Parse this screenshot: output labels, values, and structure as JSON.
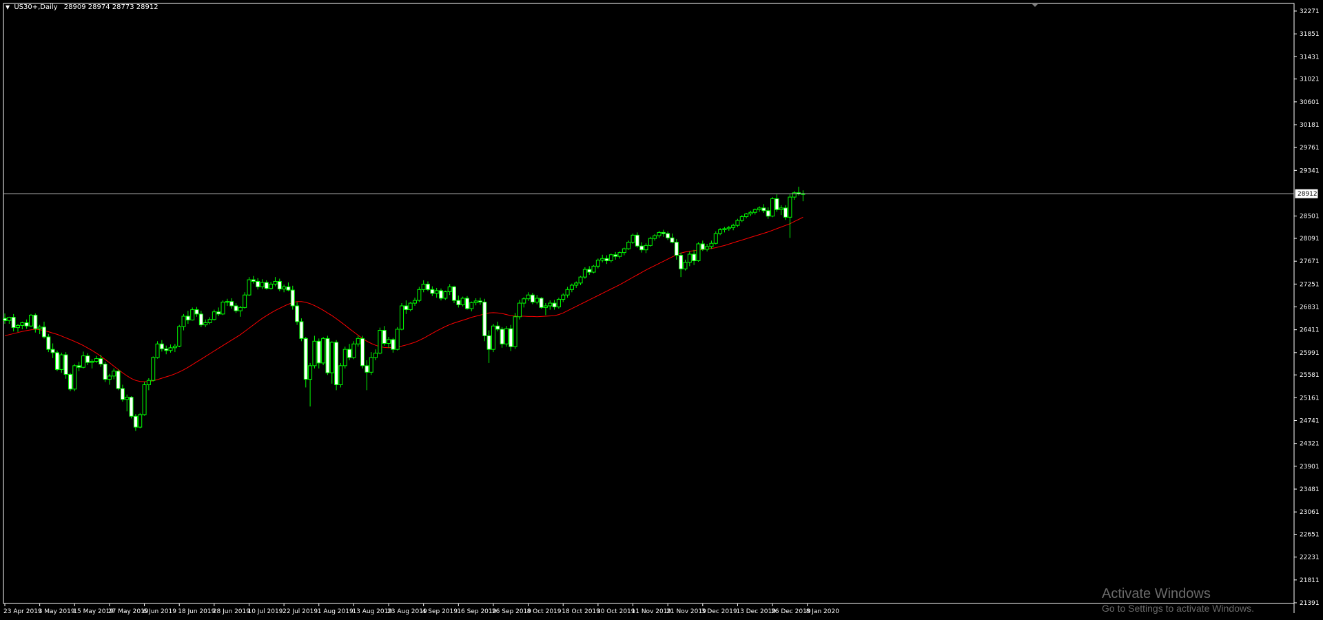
{
  "header": {
    "symbol_label": "US30+,Daily",
    "ohlc_label": "28909 28974 28773 28912"
  },
  "watermark": {
    "title": "Activate Windows",
    "subtitle": "Go to Settings to activate Windows."
  },
  "colors": {
    "background": "#000000",
    "frame": "#ffffff",
    "bull_candle": "#00ff00",
    "bull_body": "#000000",
    "bear_body": "#ffffff",
    "moving_average": "#ff0000",
    "price_line": "#c0c0c0"
  },
  "chart_data": {
    "type": "candlestick",
    "title": "",
    "symbol": "US30+",
    "timeframe": "Daily",
    "current_price": 28912,
    "current_price_label": "28912",
    "ylim": [
      21391,
      32271
    ],
    "y_ticks": [
      32271,
      31851,
      31431,
      31021,
      30601,
      30181,
      29761,
      29341,
      28501,
      28091,
      27671,
      27251,
      26831,
      26411,
      25991,
      25581,
      25161,
      24741,
      24321,
      23901,
      23481,
      23061,
      22651,
      22231,
      21811,
      21391
    ],
    "x_ticks": [
      "23 Apr 2019",
      "3 May 2019",
      "15 May 2019",
      "27 May 2019",
      "6 Jun 2019",
      "18 Jun 2019",
      "28 Jun 2019",
      "10 Jul 2019",
      "22 Jul 2019",
      "1 Aug 2019",
      "13 Aug 2019",
      "23 Aug 2019",
      "4 Sep 2019",
      "16 Sep 2019",
      "26 Sep 2019",
      "8 Oct 2019",
      "18 Oct 2019",
      "30 Oct 2019",
      "11 Nov 2019",
      "21 Nov 2019",
      "3 Dec 2019",
      "13 Dec 2019",
      "26 Dec 2019",
      "8 Jan 2020"
    ],
    "bars_per_tick": 8,
    "candles_ohlc": [
      [
        26620,
        26710,
        26520,
        26580
      ],
      [
        26580,
        26650,
        26520,
        26640
      ],
      [
        26640,
        26700,
        26380,
        26450
      ],
      [
        26450,
        26520,
        26370,
        26490
      ],
      [
        26490,
        26560,
        26420,
        26540
      ],
      [
        26540,
        26600,
        26430,
        26480
      ],
      [
        26480,
        26700,
        26460,
        26680
      ],
      [
        26680,
        26710,
        26360,
        26430
      ],
      [
        26430,
        26500,
        26330,
        26460
      ],
      [
        26460,
        26560,
        26250,
        26280
      ],
      [
        26280,
        26330,
        26000,
        26050
      ],
      [
        26050,
        26160,
        25890,
        25990
      ],
      [
        25990,
        26030,
        25650,
        25680
      ],
      [
        25680,
        25990,
        25620,
        25950
      ],
      [
        25950,
        26000,
        25510,
        25590
      ],
      [
        25590,
        25620,
        25280,
        25320
      ],
      [
        25320,
        25780,
        25280,
        25750
      ],
      [
        25750,
        25820,
        25650,
        25720
      ],
      [
        25720,
        26010,
        25700,
        25930
      ],
      [
        25930,
        25980,
        25760,
        25810
      ],
      [
        25810,
        25870,
        25700,
        25830
      ],
      [
        25830,
        25930,
        25800,
        25880
      ],
      [
        25880,
        25950,
        25730,
        25780
      ],
      [
        25780,
        25820,
        25450,
        25500
      ],
      [
        25500,
        25600,
        25400,
        25560
      ],
      [
        25560,
        25700,
        25500,
        25650
      ],
      [
        25650,
        25680,
        25300,
        25330
      ],
      [
        25330,
        25400,
        25090,
        25130
      ],
      [
        25130,
        25220,
        24910,
        25170
      ],
      [
        25170,
        25190,
        24780,
        24820
      ],
      [
        24820,
        24860,
        24550,
        24620
      ],
      [
        24620,
        24880,
        24600,
        24850
      ],
      [
        24850,
        25450,
        24830,
        25400
      ],
      [
        25400,
        25520,
        25300,
        25480
      ],
      [
        25480,
        25920,
        25460,
        25900
      ],
      [
        25900,
        26200,
        25880,
        26150
      ],
      [
        26150,
        26220,
        26010,
        26060
      ],
      [
        26060,
        26120,
        25960,
        26030
      ],
      [
        26030,
        26140,
        25990,
        26080
      ],
      [
        26080,
        26150,
        26000,
        26110
      ],
      [
        26110,
        26500,
        26090,
        26470
      ],
      [
        26470,
        26700,
        26400,
        26660
      ],
      [
        26660,
        26760,
        26520,
        26590
      ],
      [
        26590,
        26820,
        26580,
        26780
      ],
      [
        26780,
        26830,
        26650,
        26700
      ],
      [
        26700,
        26760,
        26460,
        26500
      ],
      [
        26500,
        26600,
        26460,
        26540
      ],
      [
        26540,
        26640,
        26510,
        26600
      ],
      [
        26600,
        26780,
        26580,
        26740
      ],
      [
        26740,
        26820,
        26660,
        26700
      ],
      [
        26700,
        26950,
        26680,
        26920
      ],
      [
        26920,
        26980,
        26850,
        26930
      ],
      [
        26930,
        26990,
        26800,
        26850
      ],
      [
        26850,
        26900,
        26720,
        26760
      ],
      [
        26760,
        26850,
        26650,
        26820
      ],
      [
        26820,
        27100,
        26800,
        27050
      ],
      [
        27050,
        27380,
        27030,
        27330
      ],
      [
        27330,
        27400,
        27260,
        27300
      ],
      [
        27300,
        27360,
        27150,
        27200
      ],
      [
        27200,
        27340,
        27160,
        27280
      ],
      [
        27280,
        27320,
        27150,
        27170
      ],
      [
        27170,
        27290,
        27150,
        27250
      ],
      [
        27250,
        27380,
        27210,
        27300
      ],
      [
        27300,
        27350,
        27120,
        27160
      ],
      [
        27160,
        27240,
        27100,
        27200
      ],
      [
        27200,
        27280,
        27120,
        27140
      ],
      [
        27140,
        27220,
        26780,
        26850
      ],
      [
        26850,
        26920,
        26500,
        26560
      ],
      [
        26560,
        26620,
        26200,
        26250
      ],
      [
        26250,
        26280,
        25350,
        25500
      ],
      [
        25500,
        25800,
        25000,
        25750
      ],
      [
        25750,
        26300,
        25700,
        26200
      ],
      [
        26200,
        26250,
        25700,
        25800
      ],
      [
        25800,
        26280,
        25760,
        26250
      ],
      [
        26250,
        26300,
        25580,
        25620
      ],
      [
        25620,
        26200,
        25420,
        26180
      ],
      [
        26180,
        26220,
        25300,
        25400
      ],
      [
        25400,
        25800,
        25350,
        25750
      ],
      [
        25750,
        26100,
        25700,
        26050
      ],
      [
        26050,
        26150,
        25850,
        25900
      ],
      [
        25900,
        26200,
        25870,
        26150
      ],
      [
        26150,
        26300,
        26100,
        26250
      ],
      [
        26250,
        26300,
        25700,
        25750
      ],
      [
        25750,
        25850,
        25300,
        25630
      ],
      [
        25630,
        26000,
        25580,
        25900
      ],
      [
        25900,
        26050,
        25850,
        25980
      ],
      [
        25980,
        26450,
        25960,
        26400
      ],
      [
        26400,
        26480,
        26120,
        26160
      ],
      [
        26160,
        26280,
        26080,
        26230
      ],
      [
        26230,
        26260,
        25990,
        26050
      ],
      [
        26050,
        26460,
        26030,
        26420
      ],
      [
        26420,
        26900,
        26400,
        26850
      ],
      [
        26850,
        26950,
        26700,
        26780
      ],
      [
        26780,
        26920,
        26750,
        26900
      ],
      [
        26900,
        27000,
        26850,
        26950
      ],
      [
        26950,
        27200,
        26920,
        27150
      ],
      [
        27150,
        27320,
        27100,
        27250
      ],
      [
        27250,
        27300,
        27120,
        27150
      ],
      [
        27150,
        27210,
        27030,
        27080
      ],
      [
        27080,
        27180,
        27000,
        27130
      ],
      [
        27130,
        27170,
        26950,
        26990
      ],
      [
        26990,
        27130,
        26960,
        27110
      ],
      [
        27110,
        27250,
        27050,
        27200
      ],
      [
        27200,
        27220,
        26900,
        26950
      ],
      [
        26950,
        27040,
        26820,
        26870
      ],
      [
        26870,
        27020,
        26840,
        26990
      ],
      [
        26990,
        27030,
        26780,
        26800
      ],
      [
        26800,
        26930,
        26750,
        26910
      ],
      [
        26910,
        26990,
        26860,
        26940
      ],
      [
        26940,
        27000,
        26870,
        26920
      ],
      [
        26920,
        26980,
        26200,
        26300
      ],
      [
        26300,
        26400,
        25800,
        26050
      ],
      [
        26050,
        26520,
        26000,
        26480
      ],
      [
        26480,
        26560,
        26380,
        26420
      ],
      [
        26420,
        26460,
        26080,
        26150
      ],
      [
        26150,
        26480,
        26100,
        26430
      ],
      [
        26430,
        26500,
        26020,
        26100
      ],
      [
        26100,
        26720,
        26060,
        26650
      ],
      [
        26650,
        26960,
        26600,
        26900
      ],
      [
        26900,
        27010,
        26820,
        26980
      ],
      [
        26980,
        27100,
        26940,
        27050
      ],
      [
        27050,
        27090,
        26880,
        26920
      ],
      [
        26920,
        27050,
        26880,
        26990
      ],
      [
        26990,
        27010,
        26800,
        26820
      ],
      [
        26820,
        26900,
        26680,
        26850
      ],
      [
        26850,
        26950,
        26780,
        26900
      ],
      [
        26900,
        26960,
        26780,
        26830
      ],
      [
        26830,
        27000,
        26800,
        26970
      ],
      [
        26970,
        27080,
        26920,
        27050
      ],
      [
        27050,
        27200,
        27000,
        27150
      ],
      [
        27150,
        27260,
        27100,
        27230
      ],
      [
        27230,
        27300,
        27180,
        27270
      ],
      [
        27270,
        27400,
        27230,
        27380
      ],
      [
        27380,
        27560,
        27350,
        27520
      ],
      [
        27520,
        27580,
        27420,
        27470
      ],
      [
        27470,
        27600,
        27450,
        27580
      ],
      [
        27580,
        27720,
        27540,
        27690
      ],
      [
        27690,
        27790,
        27650,
        27720
      ],
      [
        27720,
        27780,
        27620,
        27680
      ],
      [
        27680,
        27810,
        27650,
        27790
      ],
      [
        27790,
        27840,
        27700,
        27760
      ],
      [
        27760,
        27850,
        27720,
        27830
      ],
      [
        27830,
        27920,
        27780,
        27900
      ],
      [
        27900,
        28050,
        27880,
        28020
      ],
      [
        28020,
        28180,
        27990,
        28150
      ],
      [
        28150,
        28200,
        27920,
        27950
      ],
      [
        27950,
        28020,
        27830,
        27880
      ],
      [
        27880,
        28000,
        27820,
        27960
      ],
      [
        27960,
        28120,
        27940,
        28090
      ],
      [
        28090,
        28170,
        28050,
        28140
      ],
      [
        28140,
        28230,
        28100,
        28200
      ],
      [
        28200,
        28250,
        28120,
        28180
      ],
      [
        28180,
        28220,
        28060,
        28100
      ],
      [
        28100,
        28180,
        28000,
        28020
      ],
      [
        28020,
        28080,
        27700,
        27780
      ],
      [
        27780,
        27830,
        27380,
        27530
      ],
      [
        27530,
        27700,
        27500,
        27650
      ],
      [
        27650,
        27850,
        27580,
        27800
      ],
      [
        27800,
        27880,
        27600,
        27680
      ],
      [
        27680,
        28020,
        27660,
        27990
      ],
      [
        27990,
        28050,
        27860,
        27890
      ],
      [
        27890,
        27990,
        27850,
        27940
      ],
      [
        27940,
        28050,
        27900,
        28000
      ],
      [
        28000,
        28220,
        27980,
        28180
      ],
      [
        28180,
        28280,
        28150,
        28250
      ],
      [
        28250,
        28300,
        28200,
        28270
      ],
      [
        28270,
        28320,
        28230,
        28290
      ],
      [
        28290,
        28360,
        28240,
        28330
      ],
      [
        28330,
        28450,
        28300,
        28420
      ],
      [
        28420,
        28520,
        28390,
        28490
      ],
      [
        28490,
        28560,
        28460,
        28540
      ],
      [
        28540,
        28600,
        28500,
        28570
      ],
      [
        28570,
        28640,
        28530,
        28620
      ],
      [
        28620,
        28680,
        28580,
        28650
      ],
      [
        28650,
        28720,
        28560,
        28600
      ],
      [
        28600,
        28660,
        28450,
        28500
      ],
      [
        28500,
        28850,
        28480,
        28820
      ],
      [
        28820,
        28900,
        28580,
        28620
      ],
      [
        28620,
        28700,
        28520,
        28650
      ],
      [
        28650,
        28700,
        28430,
        28480
      ],
      [
        28480,
        28900,
        28100,
        28850
      ],
      [
        28850,
        28960,
        28800,
        28930
      ],
      [
        28930,
        29040,
        28880,
        28909
      ],
      [
        28909,
        28974,
        28773,
        28912
      ]
    ],
    "moving_average": {
      "color": "#ff0000",
      "values": [
        26300,
        26320,
        26340,
        26360,
        26380,
        26395,
        26410,
        26420,
        26410,
        26395,
        26375,
        26350,
        26325,
        26295,
        26262,
        26230,
        26195,
        26160,
        26120,
        26075,
        26030,
        25980,
        25925,
        25865,
        25805,
        25740,
        25680,
        25620,
        25565,
        25515,
        25480,
        25460,
        25455,
        25460,
        25475,
        25495,
        25520,
        25545,
        25570,
        25600,
        25635,
        25675,
        25720,
        25770,
        25820,
        25870,
        25920,
        25970,
        26020,
        26070,
        26120,
        26170,
        26220,
        26270,
        26320,
        26380,
        26440,
        26500,
        26560,
        26620,
        26670,
        26720,
        26765,
        26805,
        26845,
        26880,
        26910,
        26930,
        26930,
        26915,
        26890,
        26855,
        26815,
        26770,
        26720,
        26670,
        26615,
        26555,
        26495,
        26430,
        26370,
        26310,
        26250,
        26200,
        26160,
        26125,
        26100,
        26085,
        26080,
        26085,
        26095,
        26110,
        26130,
        26155,
        26180,
        26215,
        26255,
        26300,
        26345,
        26390,
        26430,
        26470,
        26505,
        26535,
        26560,
        26585,
        26610,
        26640,
        26660,
        26680,
        26700,
        26720,
        26725,
        26720,
        26710,
        26690,
        26670,
        26660,
        26660,
        26660,
        26655,
        26655,
        26650,
        26655,
        26660,
        26665,
        26670,
        26690,
        26720,
        26760,
        26800,
        26840,
        26880,
        26920,
        26960,
        27000,
        27040,
        27080,
        27120,
        27160,
        27200,
        27240,
        27285,
        27330,
        27375,
        27420,
        27465,
        27510,
        27550,
        27590,
        27630,
        27670,
        27710,
        27750,
        27790,
        27820,
        27840,
        27855,
        27865,
        27875,
        27885,
        27895,
        27905,
        27920,
        27940,
        27960,
        27985,
        28010,
        28035,
        28060,
        28085,
        28110,
        28135,
        28160,
        28185,
        28210,
        28240,
        28270,
        28300,
        28330,
        28360,
        28400,
        28440,
        28480
      ]
    }
  }
}
